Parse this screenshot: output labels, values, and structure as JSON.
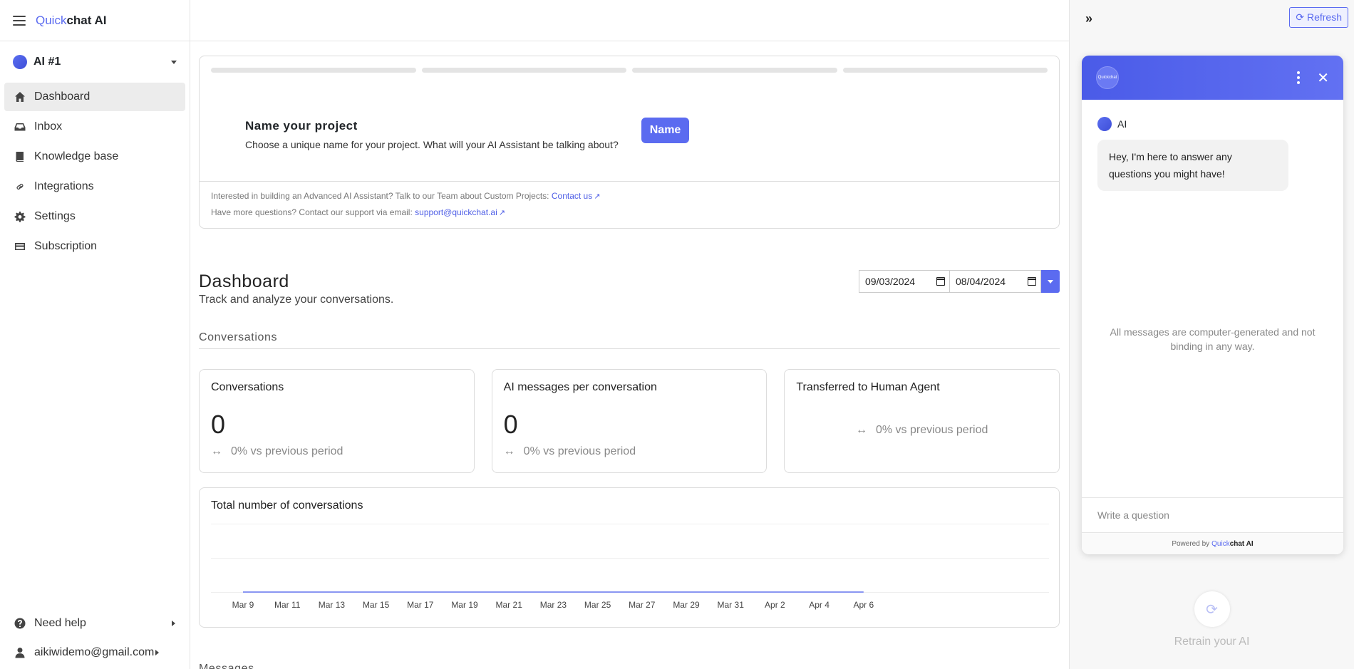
{
  "brand": {
    "prefix": "Quick",
    "suffix": "chat AI"
  },
  "project": {
    "name": "AI #1"
  },
  "nav": [
    {
      "id": "dashboard",
      "label": "Dashboard",
      "icon": "home-icon",
      "active": true
    },
    {
      "id": "inbox",
      "label": "Inbox",
      "icon": "inbox-icon",
      "active": false
    },
    {
      "id": "knowledge-base",
      "label": "Knowledge base",
      "icon": "book-icon",
      "active": false
    },
    {
      "id": "integrations",
      "label": "Integrations",
      "icon": "link-icon",
      "active": false
    },
    {
      "id": "settings",
      "label": "Settings",
      "icon": "gear-icon",
      "active": false
    },
    {
      "id": "subscription",
      "label": "Subscription",
      "icon": "credit-card-icon",
      "active": false
    }
  ],
  "sidebar_bottom": {
    "help": "Need help",
    "user": "aikiwidemo@gmail.com"
  },
  "setup": {
    "title": "Name your project",
    "description": "Choose a unique name for your project. What will your AI Assistant be talking about?",
    "button": "Name",
    "footer_line1": "Interested in building an Advanced AI Assistant? Talk to our Team about Custom Projects:",
    "footer_link1": "Contact us",
    "footer_line2": "Have more questions? Contact our support via email:",
    "footer_link2": "support@quickchat.ai"
  },
  "dashboard": {
    "title": "Dashboard",
    "subtitle": "Track and analyze your conversations.",
    "date_from": "09/03/2024",
    "date_to": "08/04/2024",
    "section": "Conversations",
    "next_section": "Messages"
  },
  "stats": [
    {
      "title": "Conversations",
      "value": "0",
      "compare": "0% vs previous period"
    },
    {
      "title": "AI messages per conversation",
      "value": "0",
      "compare": "0% vs previous period"
    },
    {
      "title": "Transferred to Human Agent",
      "value": "",
      "compare": "0% vs previous period"
    }
  ],
  "chart_data": {
    "type": "line",
    "title": "Total number of conversations",
    "x_tick_labels": [
      "Mar 9",
      "Mar 11",
      "Mar 13",
      "Mar 15",
      "Mar 17",
      "Mar 19",
      "Mar 21",
      "Mar 23",
      "Mar 25",
      "Mar 27",
      "Mar 29",
      "Mar 31",
      "Apr 2",
      "Apr 4",
      "Apr 6"
    ],
    "series": [
      {
        "values": [
          0,
          0,
          0,
          0,
          0,
          0,
          0,
          0,
          0,
          0,
          0,
          0,
          0,
          0,
          0
        ]
      }
    ],
    "grid": true,
    "color": "#8a96f2"
  },
  "right_panel": {
    "refresh": "Refresh",
    "widget_logo": "Quickchat",
    "sender": "AI",
    "greeting": "Hey, I'm here to answer any questions you might have!",
    "disclaimer": "All messages are computer-generated and not binding in any way.",
    "input_placeholder": "Write a question",
    "powered_by": "Powered by",
    "powered_brand_prefix": "Quick",
    "powered_brand_suffix": "chat AI",
    "retrain": "Retrain your AI"
  },
  "colors": {
    "accent": "#5b6bf0"
  }
}
